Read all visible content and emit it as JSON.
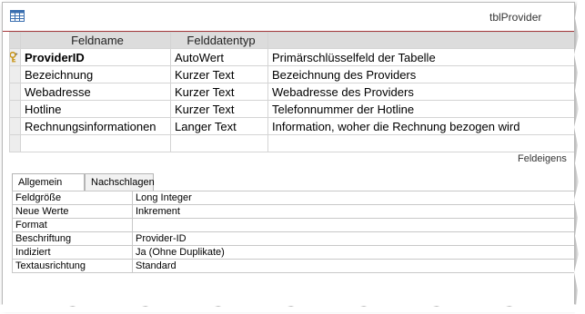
{
  "window": {
    "title": "tblProvider",
    "icon": "table-icon"
  },
  "grid": {
    "headers": [
      "Feldname",
      "Felddatentyp",
      ""
    ],
    "rows": [
      {
        "name": "ProviderID",
        "type": "AutoWert",
        "description": "Primärschlüsselfeld der Tabelle",
        "primary_key": true
      },
      {
        "name": "Bezeichnung",
        "type": "Kurzer Text",
        "description": "Bezeichnung des Providers"
      },
      {
        "name": "Webadresse",
        "type": "Kurzer Text",
        "description": "Webadresse des Providers"
      },
      {
        "name": "Hotline",
        "type": "Kurzer Text",
        "description": "Telefonnummer der Hotline"
      },
      {
        "name": "Rechnungsinformationen",
        "type": "Langer Text",
        "description": "Information, woher die Rechnung bezogen wird"
      }
    ]
  },
  "field_properties": {
    "label": "Feldeigens",
    "tabs": [
      "Allgemein",
      "Nachschlagen"
    ],
    "active_tab": "Allgemein",
    "rows": [
      {
        "property": "Feldgröße",
        "value": "Long Integer"
      },
      {
        "property": "Neue Werte",
        "value": "Inkrement"
      },
      {
        "property": "Format",
        "value": ""
      },
      {
        "property": "Beschriftung",
        "value": "Provider-ID"
      },
      {
        "property": "Indiziert",
        "value": "Ja (Ohne Duplikate)"
      },
      {
        "property": "Textausrichtung",
        "value": "Standard"
      }
    ]
  },
  "colors": {
    "accent": "#a4373a",
    "header_bg": "#dcdcdc",
    "key_icon": "#d9a520"
  }
}
